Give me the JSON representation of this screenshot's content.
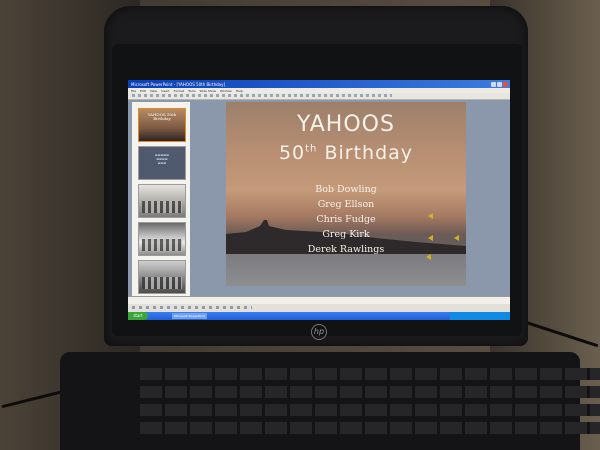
{
  "window": {
    "app_title": "Microsoft PowerPoint - [YAHOOS 50th Birthday]",
    "menus": [
      "File",
      "Edit",
      "View",
      "Insert",
      "Format",
      "Tools",
      "Slide Show",
      "Window",
      "Help"
    ]
  },
  "slide_pane": {
    "thumbnails": [
      {
        "number": "1",
        "title": "YAHOOS 50th Birthday",
        "kind": "title"
      },
      {
        "number": "2",
        "title": "",
        "kind": "text"
      },
      {
        "number": "3",
        "title": "",
        "kind": "photo"
      },
      {
        "number": "4",
        "title": "",
        "kind": "photo"
      },
      {
        "number": "5",
        "title": "",
        "kind": "photo"
      }
    ]
  },
  "slide": {
    "title_line1": "YAHOOS",
    "title_line2_num": "50",
    "title_line2_sup": "th",
    "title_line2_word": "Birthday",
    "names": [
      "Bob Dowling",
      "Greg Ellson",
      "Chris Fudge",
      "Greg Kirk",
      "Derek Rawlings"
    ]
  },
  "taskbar": {
    "start_label": "start",
    "items": [
      "Microsoft PowerPoint"
    ]
  },
  "device": {
    "logo": "hp"
  },
  "colors": {
    "title_bar": "#0a3fb7",
    "taskbar": "#1f5fd8",
    "sound_icon": "#d6b021"
  }
}
